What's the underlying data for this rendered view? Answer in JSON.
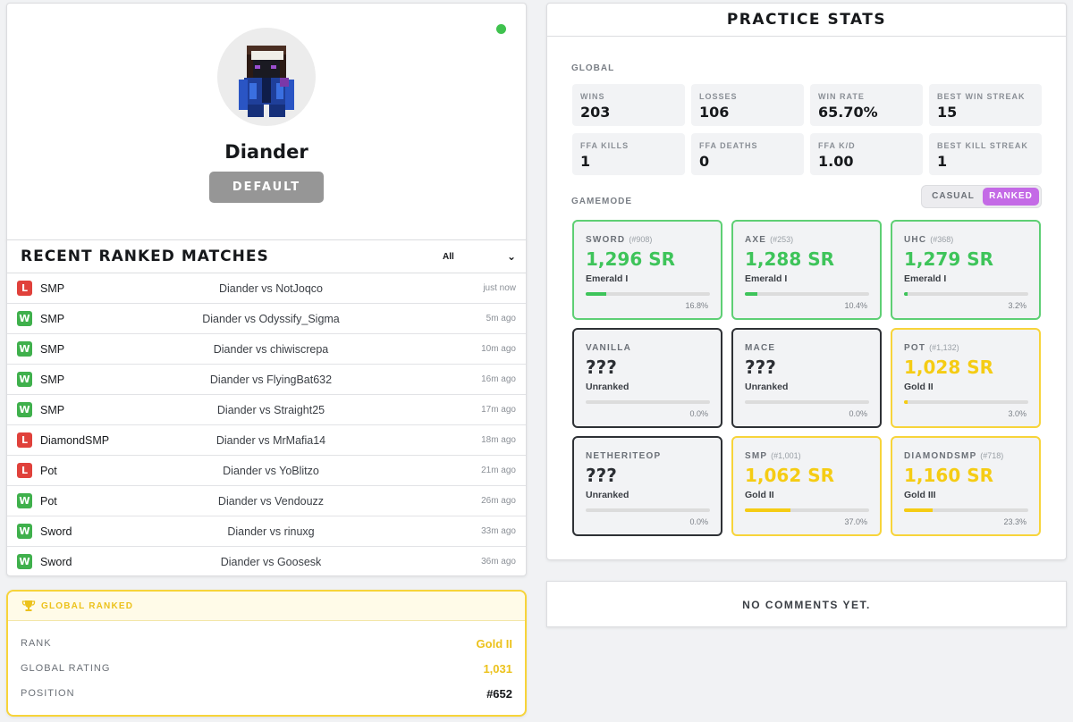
{
  "profile": {
    "username": "Diander",
    "role_label": "DEFAULT",
    "status_color": "#3fc24e"
  },
  "matches": {
    "title": "RECENT RANKED MATCHES",
    "filter_value": "All",
    "rows": [
      {
        "result": "L",
        "mode": "SMP",
        "players": "Diander vs NotJoqco",
        "time": "just now"
      },
      {
        "result": "W",
        "mode": "SMP",
        "players": "Diander vs Odyssify_Sigma",
        "time": "5m ago"
      },
      {
        "result": "W",
        "mode": "SMP",
        "players": "Diander vs chiwiscrepa",
        "time": "10m ago"
      },
      {
        "result": "W",
        "mode": "SMP",
        "players": "Diander vs FlyingBat632",
        "time": "16m ago"
      },
      {
        "result": "W",
        "mode": "SMP",
        "players": "Diander vs Straight25",
        "time": "17m ago"
      },
      {
        "result": "L",
        "mode": "DiamondSMP",
        "players": "Diander vs MrMafia14",
        "time": "18m ago"
      },
      {
        "result": "L",
        "mode": "Pot",
        "players": "Diander vs YoBlitzo",
        "time": "21m ago"
      },
      {
        "result": "W",
        "mode": "Pot",
        "players": "Diander vs Vendouzz",
        "time": "26m ago"
      },
      {
        "result": "W",
        "mode": "Sword",
        "players": "Diander vs rinuxg",
        "time": "33m ago"
      },
      {
        "result": "W",
        "mode": "Sword",
        "players": "Diander vs Goosesk",
        "time": "36m ago"
      }
    ]
  },
  "global_ranked": {
    "title": "GLOBAL RANKED",
    "rank_label": "RANK",
    "rank_value": "Gold II",
    "rating_label": "GLOBAL RATING",
    "rating_value": "1,031",
    "position_label": "POSITION",
    "position_value": "#652"
  },
  "stats": {
    "title": "PRACTICE STATS",
    "global_label": "GLOBAL",
    "global": [
      {
        "label": "WINS",
        "value": "203"
      },
      {
        "label": "LOSSES",
        "value": "106"
      },
      {
        "label": "WIN RATE",
        "value": "65.70%"
      },
      {
        "label": "BEST WIN STREAK",
        "value": "15"
      },
      {
        "label": "FFA KILLS",
        "value": "1"
      },
      {
        "label": "FFA DEATHS",
        "value": "0"
      },
      {
        "label": "FFA K/D",
        "value": "1.00"
      },
      {
        "label": "BEST KILL STREAK",
        "value": "1"
      }
    ],
    "gamemode_label": "GAMEMODE",
    "toggle": {
      "casual": "CASUAL",
      "ranked": "RANKED",
      "active": "ranked",
      "active_color": "#c46ae6"
    },
    "gamemodes": [
      {
        "name": "SWORD",
        "pos": "(#908)",
        "sr": "1,296 SR",
        "tier": "Emerald I",
        "progress": 16.8,
        "pct": "16.8%",
        "style": "green"
      },
      {
        "name": "AXE",
        "pos": "(#253)",
        "sr": "1,288 SR",
        "tier": "Emerald I",
        "progress": 10.4,
        "pct": "10.4%",
        "style": "green"
      },
      {
        "name": "UHC",
        "pos": "(#368)",
        "sr": "1,279 SR",
        "tier": "Emerald I",
        "progress": 3.2,
        "pct": "3.2%",
        "style": "green"
      },
      {
        "name": "VANILLA",
        "pos": "",
        "sr": "???",
        "tier": "Unranked",
        "progress": 0,
        "pct": "0.0%",
        "style": "dark"
      },
      {
        "name": "MACE",
        "pos": "",
        "sr": "???",
        "tier": "Unranked",
        "progress": 0,
        "pct": "0.0%",
        "style": "dark"
      },
      {
        "name": "POT",
        "pos": "(#1,132)",
        "sr": "1,028 SR",
        "tier": "Gold II",
        "progress": 3.0,
        "pct": "3.0%",
        "style": "yellow"
      },
      {
        "name": "NETHERITEOP",
        "pos": "",
        "sr": "???",
        "tier": "Unranked",
        "progress": 0,
        "pct": "0.0%",
        "style": "dark"
      },
      {
        "name": "SMP",
        "pos": "(#1,001)",
        "sr": "1,062 SR",
        "tier": "Gold II",
        "progress": 37.0,
        "pct": "37.0%",
        "style": "yellow"
      },
      {
        "name": "DIAMONDSMP",
        "pos": "(#718)",
        "sr": "1,160 SR",
        "tier": "Gold III",
        "progress": 23.3,
        "pct": "23.3%",
        "style": "yellow"
      }
    ]
  },
  "comments": {
    "empty_text": "NO COMMENTS YET."
  }
}
